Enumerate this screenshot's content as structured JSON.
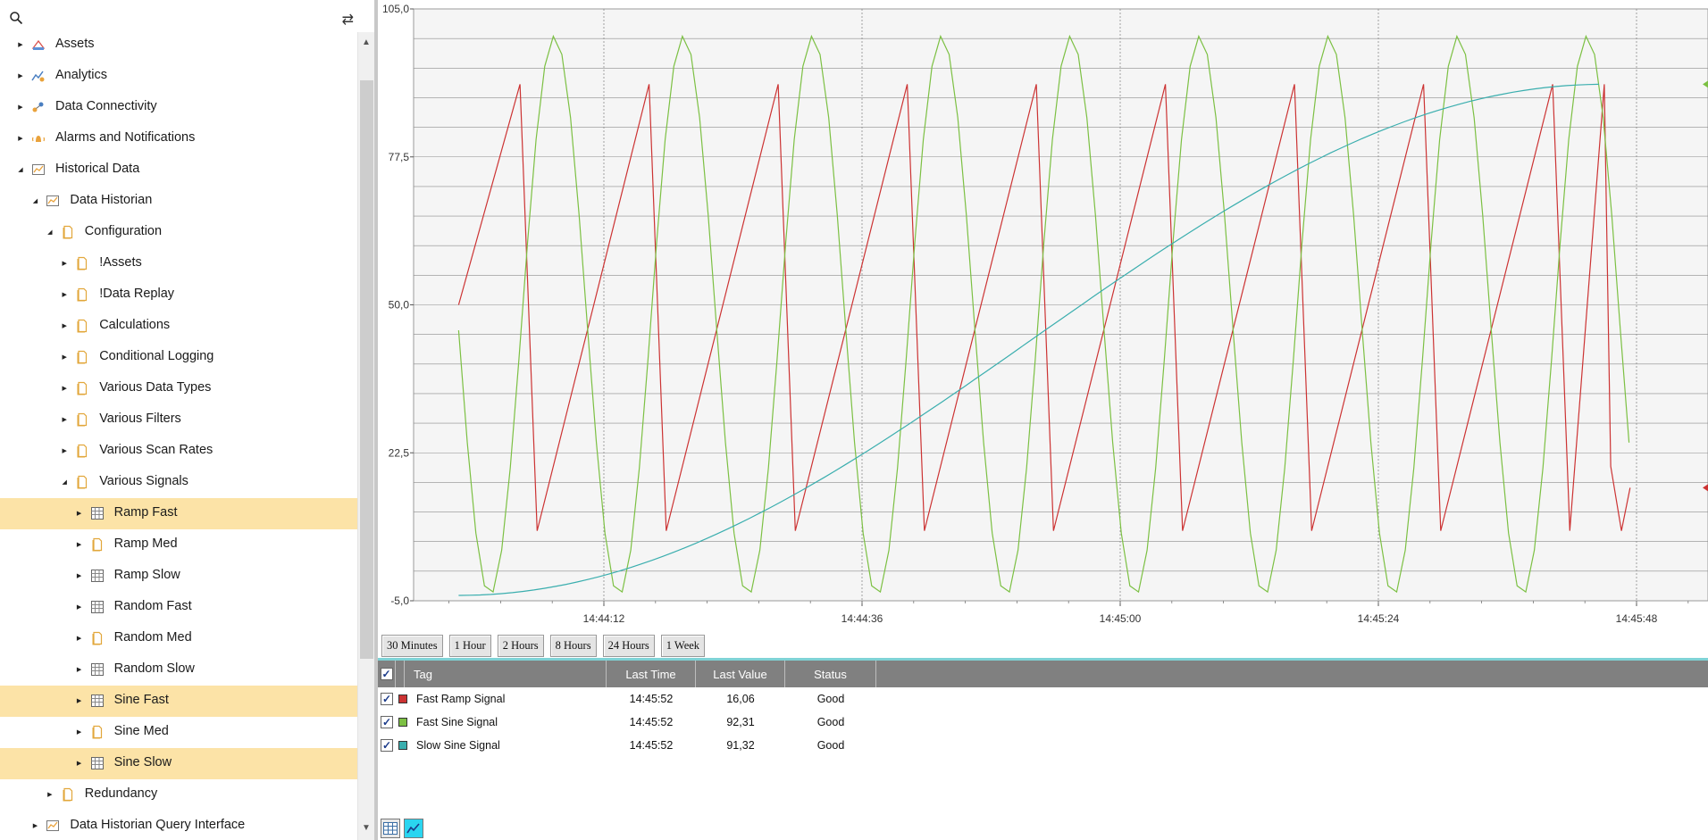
{
  "sidebar": {
    "tree": [
      {
        "label": "Assets",
        "level": 0,
        "expanded": false,
        "icon": "assets-icon",
        "selected": false
      },
      {
        "label": "Analytics",
        "level": 0,
        "expanded": false,
        "icon": "analytics-icon",
        "selected": false
      },
      {
        "label": "Data Connectivity",
        "level": 0,
        "expanded": false,
        "icon": "data-connectivity-icon",
        "selected": false
      },
      {
        "label": "Alarms and Notifications",
        "level": 0,
        "expanded": false,
        "icon": "alarms-icon",
        "selected": false
      },
      {
        "label": "Historical Data",
        "level": 0,
        "expanded": true,
        "icon": "historical-data-icon",
        "selected": false
      },
      {
        "label": "Data Historian",
        "level": 1,
        "expanded": true,
        "icon": "historian-icon",
        "selected": false
      },
      {
        "label": "Configuration",
        "level": 2,
        "expanded": true,
        "icon": "folder-icon",
        "selected": false
      },
      {
        "label": "!Assets",
        "level": 3,
        "expanded": false,
        "icon": "folder-icon",
        "selected": false
      },
      {
        "label": "!Data Replay",
        "level": 3,
        "expanded": false,
        "icon": "folder-icon",
        "selected": false
      },
      {
        "label": "Calculations",
        "level": 3,
        "expanded": false,
        "icon": "folder-icon",
        "selected": false
      },
      {
        "label": "Conditional Logging",
        "level": 3,
        "expanded": false,
        "icon": "folder-icon",
        "selected": false
      },
      {
        "label": "Various Data Types",
        "level": 3,
        "expanded": false,
        "icon": "folder-icon",
        "selected": false
      },
      {
        "label": "Various Filters",
        "level": 3,
        "expanded": false,
        "icon": "folder-icon",
        "selected": false
      },
      {
        "label": "Various Scan Rates",
        "level": 3,
        "expanded": false,
        "icon": "folder-icon",
        "selected": false
      },
      {
        "label": "Various Signals",
        "level": 3,
        "expanded": true,
        "icon": "folder-icon",
        "selected": false
      },
      {
        "label": "Ramp Fast",
        "level": 4,
        "expanded": false,
        "icon": "grid-icon",
        "selected": true
      },
      {
        "label": "Ramp Med",
        "level": 4,
        "expanded": false,
        "icon": "folder-icon",
        "selected": false
      },
      {
        "label": "Ramp Slow",
        "level": 4,
        "expanded": false,
        "icon": "grid-icon",
        "selected": false
      },
      {
        "label": "Random Fast",
        "level": 4,
        "expanded": false,
        "icon": "grid-icon",
        "selected": false
      },
      {
        "label": "Random Med",
        "level": 4,
        "expanded": false,
        "icon": "folder-icon",
        "selected": false
      },
      {
        "label": "Random Slow",
        "level": 4,
        "expanded": false,
        "icon": "grid-icon",
        "selected": false
      },
      {
        "label": "Sine Fast",
        "level": 4,
        "expanded": false,
        "icon": "grid-icon",
        "selected": true
      },
      {
        "label": "Sine Med",
        "level": 4,
        "expanded": false,
        "icon": "folder-icon",
        "selected": false
      },
      {
        "label": "Sine Slow",
        "level": 4,
        "expanded": false,
        "icon": "grid-icon",
        "selected": true
      },
      {
        "label": "Redundancy",
        "level": 2,
        "expanded": false,
        "icon": "folder-icon",
        "selected": false
      },
      {
        "label": "Data Historian Query Interface",
        "level": 1,
        "expanded": false,
        "icon": "historian-icon",
        "selected": false
      }
    ]
  },
  "chart_data": {
    "type": "line",
    "ylim": [
      -5.0,
      105.0
    ],
    "yticks": [
      "105,0",
      "77,5",
      "50,0",
      "22,5",
      "-5,0"
    ],
    "ytick_values": [
      105.0,
      77.5,
      50.0,
      22.5,
      -5.0
    ],
    "xlim_seconds": [
      0,
      96
    ],
    "xticks": [
      "14:44:12",
      "14:44:36",
      "14:45:00",
      "14:45:24",
      "14:45:48"
    ],
    "xtick_seconds": [
      22,
      46,
      70,
      94,
      118
    ],
    "series": [
      {
        "name": "Fast Ramp Signal",
        "color": "#cc3333",
        "kind": "ramp",
        "period": 12,
        "min": 8,
        "max": 91,
        "phase": 0,
        "start": 50
      },
      {
        "name": "Fast Sine Signal",
        "color": "#7cc043",
        "kind": "sine",
        "period": 12,
        "min": -4,
        "max": 100,
        "phase": 0
      },
      {
        "name": "Slow Sine Signal",
        "color": "#3aaeae",
        "kind": "slowsine",
        "from": -4,
        "to": 91
      }
    ]
  },
  "range_buttons": [
    "30 Minutes",
    "1 Hour",
    "2 Hours",
    "8 Hours",
    "24 Hours",
    "1 Week"
  ],
  "table": {
    "headers": {
      "tag": "Tag",
      "last_time": "Last Time",
      "last_value": "Last Value",
      "status": "Status"
    },
    "rows": [
      {
        "tag": "Fast Ramp Signal",
        "color": "#cc3333",
        "last_time": "14:45:52",
        "last_value": "16,06",
        "status": "Good"
      },
      {
        "tag": "Fast Sine Signal",
        "color": "#7cc043",
        "last_time": "14:45:52",
        "last_value": "92,31",
        "status": "Good"
      },
      {
        "tag": "Slow Sine Signal",
        "color": "#3aaeae",
        "last_time": "14:45:52",
        "last_value": "91,32",
        "status": "Good"
      }
    ]
  },
  "bottom_buttons": [
    {
      "icon": "table-view-icon"
    },
    {
      "icon": "chart-view-icon"
    }
  ]
}
